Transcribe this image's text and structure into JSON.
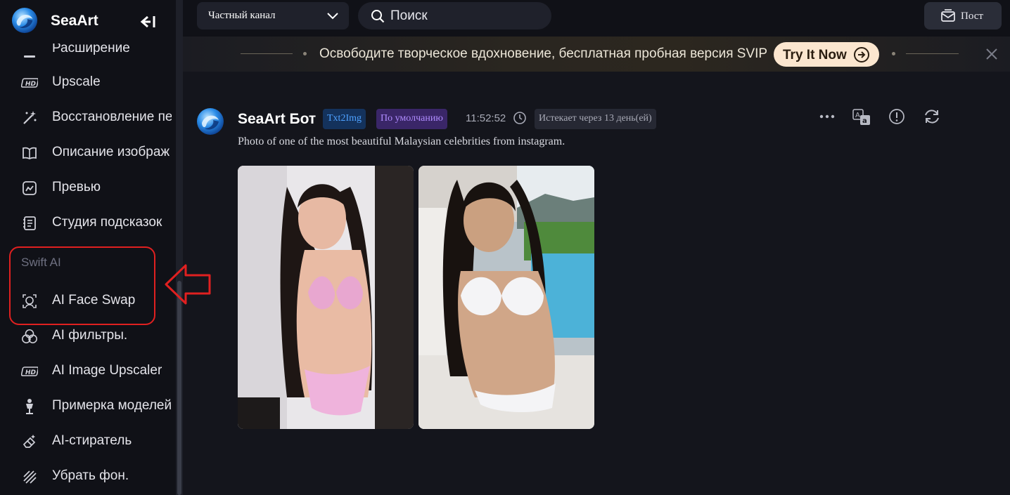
{
  "app": {
    "brand": "SeaArt"
  },
  "sidebar": {
    "items": [
      {
        "label": "Расширение",
        "icon": "extension-icon"
      },
      {
        "label": "Upscale",
        "icon": "hd-icon"
      },
      {
        "label": "Восстановление пе",
        "icon": "magic-wand-icon"
      },
      {
        "label": "Описание изображ",
        "icon": "book-icon"
      },
      {
        "label": "Превью",
        "icon": "preview-icon"
      },
      {
        "label": "Студия подсказок",
        "icon": "notebook-icon"
      }
    ],
    "section_title": "Swift AI",
    "swift_items": [
      {
        "label": "AI Face Swap",
        "icon": "face-swap-icon"
      },
      {
        "label": "AI фильтры.",
        "icon": "filters-icon"
      },
      {
        "label": "AI Image Upscaler",
        "icon": "hd-icon"
      },
      {
        "label": "Примерка моделей",
        "icon": "mannequin-icon"
      },
      {
        "label": "AI-стиратель",
        "icon": "eraser-icon"
      },
      {
        "label": "Убрать фон.",
        "icon": "stripes-icon"
      }
    ]
  },
  "topbar": {
    "channel": "Частный канал",
    "search_placeholder": "Поиск",
    "post_label": "Пост"
  },
  "promo": {
    "text": "Освободите творческое вдохновение, бесплатная пробная версия SVIP",
    "button": "Try It Now"
  },
  "message": {
    "bot_name": "SeaArt Бот",
    "tag_mode": "Txt2Img",
    "tag_preset": "По умолчанию",
    "time": "11:52:52",
    "expires": "Истекает через 13 день(ей)",
    "prompt": "Photo of one of the most beautiful Malaysian celebrities from instagram."
  },
  "colors": {
    "bg": "#14151c",
    "sidebar_bg": "#101117",
    "accent_blue": "#4ea1ff",
    "accent_purple": "#b08cff",
    "promo_button": "#fbe6cf",
    "annotation_red": "#e02020"
  }
}
